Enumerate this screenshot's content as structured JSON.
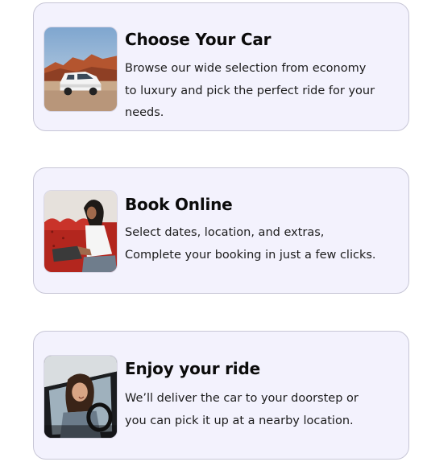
{
  "steps": [
    {
      "title": "Choose Your Car",
      "image_icon": "suv-desert-photo",
      "lines": [
        "Browse our wide selection from economy",
        "to luxury and pick the perfect ride for your",
        "needs."
      ]
    },
    {
      "title": "Book Online",
      "image_icon": "woman-laptop-photo",
      "lines": [
        "Select dates, location, and extras,",
        "Complete your booking in just a few clicks."
      ]
    },
    {
      "title": "Enjoy your ride",
      "image_icon": "woman-driving-photo",
      "lines": [
        "We’ll deliver the car to your doorstep or",
        "you can pick it up at a nearby location."
      ]
    }
  ],
  "colors": {
    "card_background": "#f3f2fd",
    "card_border": "#c7c6d6",
    "title_text": "#0b0b0b",
    "body_text": "#1c1c1c"
  }
}
